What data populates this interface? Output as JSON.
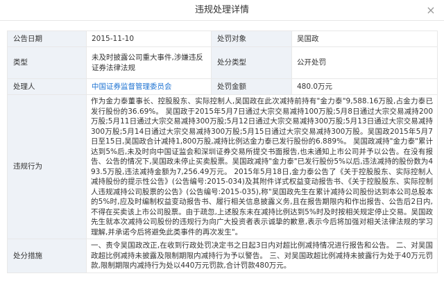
{
  "modal": {
    "title": "违规处理详情",
    "close_label": "×"
  },
  "labels": {
    "announce_date": "公告日期",
    "target": "处罚对象",
    "type": "类型",
    "punish_type": "处分类型",
    "handler": "处理人",
    "amount": "处罚金额",
    "violation": "违规行为",
    "measures": "处分措施"
  },
  "values": {
    "announce_date": "2015-11-10",
    "target": "吴国政",
    "type": "未及时披露公司重大事件,涉嫌违反证券法律法规",
    "punish_type": "公开处罚",
    "handler": "中国证券监督管理委员会",
    "amount": "480.0万元",
    "violation": "作为金力泰董事长、控股股东、实际控制人,吴国政在此次减持前持有\"金力泰\"9,588.16万股,占金力泰已发行股份的36.69%。 吴国政于2015年5月7日通过大宗交易减持100万股;5月8日通过大宗交易减持200万股;5月11日通过大宗交易减持300万股;5月12日通过大宗交易减持300万股;5月13日通过大宗交易减持300万股;5月14日通过大宗交易减持300万股;5月15日通过大宗交易减持300万股。吴国政2015年5月7日至15日,吴国政合计减持1,800万股,减持比例达金力泰已发行股份的6.889%。 吴国政减持\"金力泰\"累计达到5%后,未及时向中国证监会和深圳证券交易所提交书面报告,也未通知上市公司并予以公告。在没有报告、公告的情况下,吴国政未停止买卖股票。吴国政减持\"金力泰\"已发行股份5%以后,违法减持的股份数为493.5万股,违法减持金额为7,256.49万元。 2015年5月18日,金力泰公告了《关于控股股东、实际控制人减持股份的提示性公告》(公告编号:2015-034)及其附件详式权益变动报告书、《关于控股股东、实际控制人违规减持公司股票的公告》(公告编号:2015-035),称\"吴国政先生在累计减持公司股份达到本公司总股本的5%时,应及时编制权益变动报告书、履行相关信息披露义务,且在报告期限内和作出报告、公告后2日内,不得在买卖该上市公司股票。由于疏忽,上述股东未在减持比例达到5%时及时按相关规定停止交易。吴国政先生就本次减持公司股份的违规行为向广大投资者表示诚挚的歉意,表示今后将加强对相关法律法规的学习理解,并承诺今后将避免此类事件的再次发生\"。",
    "measures": "一、责令吴国政改正,在收到行政处罚决定书之日起3日内对超比例减持情况进行报告和公告。 二、对吴国政超比例减持未披露及限制期限内减持行为予以警告。 三、对吴国政超比例减持未披露行为处于40万元罚款,限制期限内减持行为处以440万元罚款,合计罚款480万元。"
  }
}
